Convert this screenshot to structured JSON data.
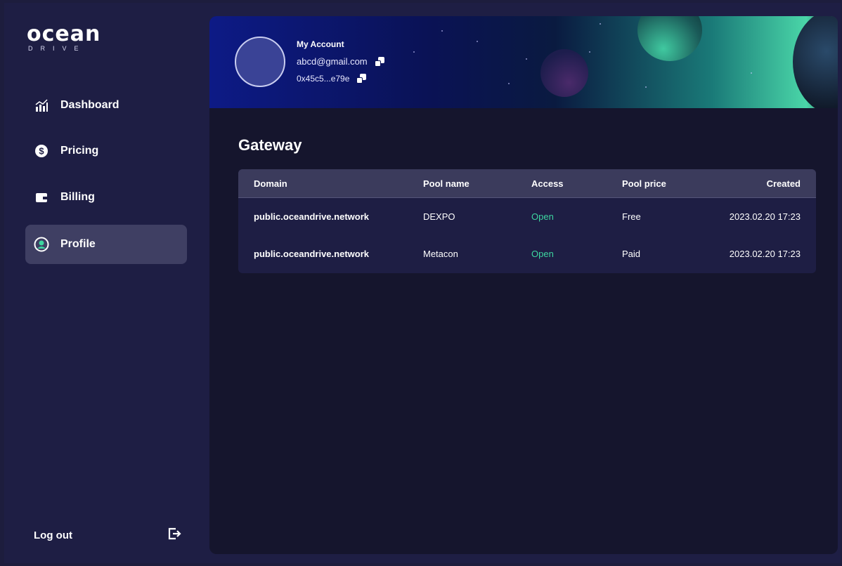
{
  "brand": {
    "name": "ocean",
    "tagline": "DRIVE"
  },
  "sidebar": {
    "items": [
      {
        "label": "Dashboard",
        "icon": "chart-icon",
        "active": false
      },
      {
        "label": "Pricing",
        "icon": "dollar-icon",
        "active": false
      },
      {
        "label": "Billing",
        "icon": "wallet-icon",
        "active": false
      },
      {
        "label": "Profile",
        "icon": "user-icon",
        "active": true
      }
    ],
    "logout_label": "Log out",
    "logout_icon": "logout-icon"
  },
  "account": {
    "title": "My Account",
    "email": "abcd@gmail.com",
    "wallet": "0x45c5...e79e"
  },
  "gateway": {
    "title": "Gateway",
    "columns": [
      "Domain",
      "Pool name",
      "Access",
      "Pool price",
      "Created"
    ],
    "rows": [
      {
        "domain": "public.oceandrive.network",
        "pool": "DEXPO",
        "access": "Open",
        "price": "Free",
        "created": "2023.02.20 17:23"
      },
      {
        "domain": "public.oceandrive.network",
        "pool": "Metacon",
        "access": "Open",
        "price": "Paid",
        "created": "2023.02.20 17:23"
      }
    ]
  },
  "colors": {
    "accent_open": "#3dd6a0",
    "active_nav": "#3f3f63",
    "background": "#1e1e44"
  }
}
